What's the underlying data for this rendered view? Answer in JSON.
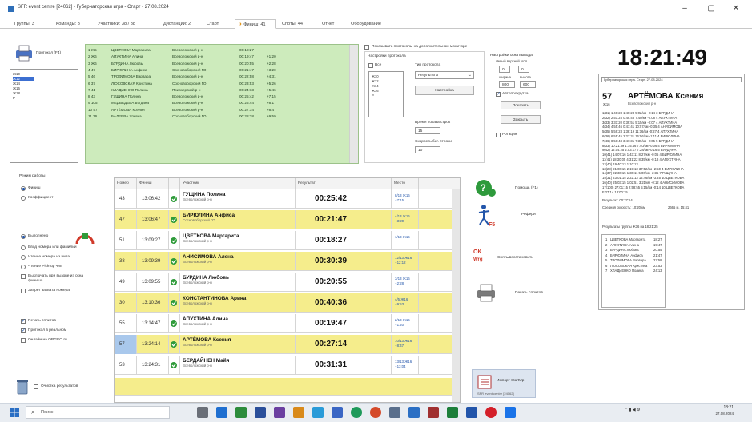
{
  "window": {
    "title": "SFR event centre [24062] - Губернаторская игра - Старт - 27.08.2024",
    "min": "–",
    "max": "▢",
    "close": "✕"
  },
  "tabs": [
    "Группы: 3",
    "Команды: 3",
    "Участники: 38 / 38",
    "Дистанции: 2",
    "Старт",
    "Финиш: 41",
    "Споты: 44",
    "Отчет",
    "Оборудование"
  ],
  "left": {
    "protocol_btn": "Протокол (F4)",
    "groups": [
      "Ж10",
      "Ж12",
      "Ж14",
      "Ж16",
      "Ж18",
      "Р"
    ],
    "work_mode_title": "Режим работы",
    "modes": [
      "Финиш",
      "Коэффициент"
    ],
    "options": [
      {
        "label": "Выполнено",
        "on": true
      },
      {
        "label": "Ввод номера или фамилии",
        "on": false
      },
      {
        "label": "Чтение номера из чипа",
        "on": false
      },
      {
        "label": "Чтение Pick-up чип",
        "on": false
      },
      {
        "label": "Выключать при вызове из окна финиша",
        "on": false
      },
      {
        "label": "Запрет захвата номера",
        "on": false
      }
    ],
    "checks": [
      {
        "label": "Печать сплитов",
        "on": true
      },
      {
        "label": "Протокол в реальном",
        "on": true
      },
      {
        "label": "Онлайн на ORGEO.ru",
        "on": false
      }
    ],
    "clear_results": "Очистка результатов"
  },
  "green_table": {
    "rows": [
      {
        "no": "1 Ж5",
        "place": "1",
        "name": "ЦВЕТКОВА Маргарита",
        "team": "Всеволожский р-н",
        "time": "00:18:27",
        "diff": ""
      },
      {
        "no": "2 Ж6",
        "place": "2",
        "name": "АПУХТИНА Алина",
        "team": "Всеволожский р-н",
        "time": "00:19:47",
        "diff": "+1:20"
      },
      {
        "no": "3 Ж6",
        "place": "3",
        "name": "БУРДИНА Любовь",
        "team": "Всеволожский р-н",
        "time": "00:20:55",
        "diff": "+2:28"
      },
      {
        "no": "4 47",
        "place": "4",
        "name": "БИРЮЛИНА Анфиса",
        "team": "Сосновоборский ГО",
        "time": "00:21:47",
        "diff": "+3:20"
      },
      {
        "no": "5 46",
        "place": "5",
        "name": "ТРОФИМОВА Варвара",
        "team": "Всеволожский р-н",
        "time": "00:22:58",
        "diff": "+4:31"
      },
      {
        "no": "6 37",
        "place": "6",
        "name": "ЛЮСОВСКАЯ Кристина",
        "team": "Сосновоборский ГО",
        "time": "00:23:53",
        "diff": "+5:26"
      },
      {
        "no": "7 41",
        "place": "7",
        "name": "ХЛАДИЕНКО Полина",
        "team": "Приозерский р-н",
        "time": "00:24:13",
        "diff": "+5:46"
      },
      {
        "no": "8 43",
        "place": "8",
        "name": "ГУЩИНА Полина",
        "team": "Всеволожский р-н",
        "time": "00:25:42",
        "diff": "+7:15"
      },
      {
        "no": "9 105",
        "place": "9",
        "name": "МЕДВЕДЕВА Богдана",
        "team": "Всеволожский р-н",
        "time": "00:26:44",
        "diff": "+8:17"
      },
      {
        "no": "10 57",
        "place": "10",
        "name": "АРТЁМОВА Ксения",
        "team": "Всеволожский р-н",
        "time": "00:27:14",
        "diff": "+8:47"
      },
      {
        "no": "11 36",
        "place": "11",
        "name": "БАЛЕЕВА Ульяна",
        "team": "Сосновоборский ГО",
        "time": "00:28:28",
        "diff": "+9:59"
      }
    ]
  },
  "settings": {
    "show_extra": "Показывать протоколы на дополнительном мониторе",
    "protocol_title": "Настройки протокола",
    "all": "Все",
    "type_label": "Тип протокола",
    "type_value": "Результаты",
    "groups": [
      "Ж10",
      "Ж12",
      "Ж14",
      "Ж16",
      "Р"
    ],
    "setup_btn": "Настройка",
    "show_time_label": "Время показа строк",
    "show_time_value": "15",
    "speed_label": "Скорость бег. строки",
    "speed_value": "10",
    "window_title": "Настройки окна вывода",
    "corner_label": "Левый верхний угол",
    "x_value": "0",
    "y_value": "0",
    "w_label": "ширина",
    "h_label": "высота",
    "w_value": "800",
    "h_value": "600",
    "autoscroll": "Автопрокрутка",
    "show_btn": "Показать",
    "close_btn": "Закрыть",
    "loop": "Ротация"
  },
  "finish_table": {
    "headers": [
      "Номер",
      "Финиш",
      "",
      "Участник",
      "Результат",
      "Место"
    ],
    "rows": [
      {
        "num": "43",
        "time": "13:06:42",
        "name": "ГУЩИНА Полина",
        "team": "Всеволожский р-н",
        "result": "00:25:42",
        "place1": "8/13 Ж16",
        "place2": "+7:15",
        "yellow": false
      },
      {
        "num": "47",
        "time": "13:06:47",
        "name": "БИРЮЛИНА Анфиса",
        "team": "Сосновоборский ГО",
        "result": "00:21:47",
        "place1": "4/13 Ж16",
        "place2": "+3:20",
        "yellow": true
      },
      {
        "num": "51",
        "time": "13:09:27",
        "name": "ЦВЕТКОВА Маргарита",
        "team": "Всеволожский р-н",
        "result": "00:18:27",
        "place1": "1/13 Ж16",
        "place2": "",
        "yellow": false
      },
      {
        "num": "38",
        "time": "13:09:39",
        "name": "АНИСИМОВА Алена",
        "team": "Всеволожский р-н",
        "result": "00:30:39",
        "place1": "12/13 Ж16",
        "place2": "+12:12",
        "yellow": true
      },
      {
        "num": "49",
        "time": "13:09:55",
        "name": "БУРДИНА Любовь",
        "team": "Всеволожский р-н",
        "result": "00:20:55",
        "place1": "3/13 Ж16",
        "place2": "+2:28",
        "yellow": false
      },
      {
        "num": "30",
        "time": "13:10:36",
        "name": "КОНСТАНТИНОВА Арина",
        "team": "Всеволожский р-н",
        "result": "00:40:36",
        "place1": "4/5 Ж16",
        "place2": "+9:53",
        "yellow": true
      },
      {
        "num": "55",
        "time": "13:14:47",
        "name": "АПУХТИНА Алина",
        "team": "Всеволожский р-н",
        "result": "00:19:47",
        "place1": "2/13 Ж16",
        "place2": "+1:20",
        "yellow": false
      },
      {
        "num": "57",
        "time": "13:24:14",
        "name": "АРТЁМОВА Ксения",
        "team": "Всеволожский р-н",
        "result": "00:27:14",
        "place1": "10/13 Ж16",
        "place2": "+8:47",
        "yellow": true
      },
      {
        "num": "53",
        "time": "13:24:31",
        "name": "БЕРДАЙНЕН Майя",
        "team": "Всеволожский р-н",
        "result": "00:31:31",
        "place1": "13/13 Ж16",
        "place2": "+13:04",
        "yellow": false
      }
    ]
  },
  "actions": {
    "help": "Помощь (F1)",
    "referee": "Рефери",
    "ok_label": "ОК",
    "ok_sub": "Wrg",
    "mismatch": "Снять/восстановить",
    "print": "Печать сплитов",
    "import": "Импорт StartUp",
    "footer": "SFR event centre [24062]"
  },
  "clock": "18:21:49",
  "card": {
    "header": "Губернаторская игра. Старт. 27.08.2024",
    "bib": "57",
    "group": "Ж16",
    "name": "АРТЁМОВА Ксения",
    "team": "Всеволожский р-н",
    "splits": [
      "1(31)   1:40:23   1:40:23   5:02/км   -0:14 3 БУРДИНА",
      "2(32)   2:51:25   0:49:48   7:40/км   -0:08 4 АПУХТИНА",
      "3(33)   3:31:20   0:39:51   5:15/км   -0:07 4 АПУХТИНА",
      "4(34)   4:55:46   0:41:41   10:57/км  -0:35 4 АНИСИМОВА",
      "5(35)   5:59:23   1:38:19   11:16/км  -0:27 4 АПУХТИНА",
      "6(36)   6:55:45   2:21:31   16:56/км  -1:11 4 БИРЮЛИНА",
      "7(46)   8:58:48   3:47:31   7:39/км   -0:05 5 БУРДИНА",
      "8(33)   10:21:39  1:15:46   7:40/км   -0:06 4 БИРЮЛИНА",
      "9(42)   12:04:25  2:03:17   7:28/км   -0:16 5 БУРДИНА",
      "10(41)  14:07:16  1:43:11   8:27/км   -0:05 4 БИРЮЛИНА",
      "11(41)  18:30:05  4:31:22   8:35/км   -0:18 4 АПУХТИНА",
      "12(40)  19:40:13  1:10:13",
      "13(28)  21:00:15  2:19:13   37:52/км  -2:50 4 БИРЮЛИНА",
      "14(37)  22:30:15  1:30:11   5:00/км   -2:35 7 ГУЩИНА",
      "15(31)  23:01:15  2:22:13   12:46/км  -3:45 10 ЦВЕТКОВА",
      "16(40)  25:03:15  1:02:51   3:21/км   -0:12 4 АНИСИМОВА",
      "17(100) 27:01:15  2:58:55   5:15/км   -0:14 10 ЦВЕТКОВА",
      "F       27:14     13:00:15"
    ],
    "result_label": "Результат: 00:27:14",
    "speed_label": "Средняя скорость: 10:20/км",
    "distance": "2665 м, 15:41",
    "group_results_title": "Результаты группы Ж16 на 18:21:25",
    "group_results": [
      {
        "n": "1",
        "name": "ЦВЕТКОВА Маргарита",
        "time": "18:27"
      },
      {
        "n": "2",
        "name": "АПУХТИНА Алина",
        "time": "19:47"
      },
      {
        "n": "3",
        "name": "БУРДИНА Любовь",
        "time": "20:55"
      },
      {
        "n": "4",
        "name": "БИРЮЛИНА Анфиса",
        "time": "21:47"
      },
      {
        "n": "5",
        "name": "ТРОФИМОВА Варвара",
        "time": "22:58"
      },
      {
        "n": "6",
        "name": "ЛЮСОВСКАЯ Кристина",
        "time": "23:53"
      },
      {
        "n": "7",
        "name": "ХЛАДИЕНКО Полина",
        "time": "24:13"
      }
    ]
  },
  "taskbar": {
    "search": "Поиск",
    "time": "18:21",
    "date": "27.08.2024"
  }
}
